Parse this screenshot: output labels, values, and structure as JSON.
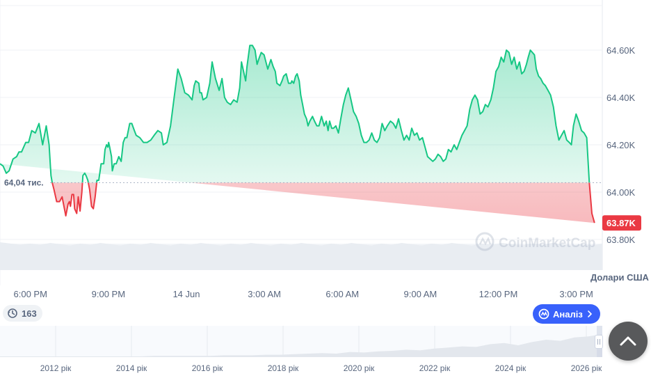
{
  "chart_data": {
    "type": "area",
    "baseline": {
      "value": 64040,
      "label": "64,04 тис."
    },
    "current": {
      "value": 63870,
      "label": "63.87K"
    },
    "ylim": [
      63800,
      64660
    ],
    "yticks": [
      {
        "value": 64600,
        "label": "64.60K"
      },
      {
        "value": 64400,
        "label": "64.40K"
      },
      {
        "value": 64200,
        "label": "64.20K"
      },
      {
        "value": 64000,
        "label": "64.00K"
      },
      {
        "value": 63800,
        "label": "63.80K"
      }
    ],
    "currency_label": "Долари США",
    "watermark": "CoinMarketCap",
    "xlim": [
      16.83,
      40.0
    ],
    "xticks": [
      {
        "value": 18,
        "label": "6:00 PM"
      },
      {
        "value": 21,
        "label": "9:00 PM"
      },
      {
        "value": 24,
        "label": "14 Jun"
      },
      {
        "value": 27,
        "label": "3:00 AM"
      },
      {
        "value": 30,
        "label": "6:00 AM"
      },
      {
        "value": 33,
        "label": "9:00 AM"
      },
      {
        "value": 36,
        "label": "12:00 PM"
      },
      {
        "value": 39,
        "label": "3:00 PM"
      }
    ],
    "x": [
      16.83,
      16.95,
      17.07,
      17.18,
      17.33,
      17.47,
      17.56,
      17.66,
      17.82,
      17.93,
      18.05,
      18.19,
      18.33,
      18.47,
      18.61,
      18.72,
      18.79,
      18.84,
      18.91,
      19.01,
      19.12,
      19.22,
      19.36,
      19.45,
      19.5,
      19.54,
      19.6,
      19.66,
      19.7,
      19.78,
      19.84,
      19.91,
      19.98,
      20.02,
      20.09,
      20.14,
      20.21,
      20.28,
      20.35,
      20.42,
      20.49,
      20.56,
      20.63,
      20.72,
      20.82,
      20.87,
      20.93,
      20.98,
      21.01,
      21.05,
      21.12,
      21.15,
      21.22,
      21.3,
      21.4,
      21.49,
      21.57,
      21.64,
      21.71,
      21.82,
      21.9,
      22.0,
      22.07,
      22.21,
      22.35,
      22.49,
      22.63,
      22.76,
      22.9,
      23.04,
      23.11,
      23.25,
      23.39,
      23.53,
      23.67,
      23.8,
      23.94,
      24.08,
      24.22,
      24.3,
      24.36,
      24.48,
      24.52,
      24.58,
      24.64,
      24.78,
      24.9,
      24.99,
      25.12,
      25.26,
      25.37,
      25.47,
      25.57,
      25.7,
      25.82,
      25.95,
      26.05,
      26.12,
      26.2,
      26.28,
      26.33,
      26.44,
      26.54,
      26.64,
      26.72,
      26.81,
      26.88,
      26.99,
      27.13,
      27.25,
      27.34,
      27.42,
      27.48,
      27.6,
      27.68,
      27.74,
      27.84,
      27.93,
      28.02,
      28.06,
      28.13,
      28.2,
      28.26,
      28.34,
      28.4,
      28.47,
      28.54,
      28.62,
      28.68,
      28.75,
      28.85,
      28.93,
      29.02,
      29.1,
      29.2,
      29.3,
      29.38,
      29.45,
      29.51,
      29.59,
      29.66,
      29.75,
      29.85,
      29.94,
      30.04,
      30.13,
      30.23,
      30.33,
      30.43,
      30.53,
      30.63,
      30.73,
      30.83,
      30.93,
      31.03,
      31.13,
      31.23,
      31.33,
      31.43,
      31.53,
      31.63,
      31.73,
      31.85,
      31.96,
      32.06,
      32.16,
      32.27,
      32.37,
      32.47,
      32.57,
      32.67,
      32.77,
      32.87,
      32.97,
      33.08,
      33.18,
      33.28,
      33.38,
      33.48,
      33.58,
      33.68,
      33.78,
      33.88,
      33.98,
      34.08,
      34.18,
      34.3,
      34.4,
      34.5,
      34.6,
      34.7,
      34.8,
      34.9,
      35.0,
      35.1,
      35.2,
      35.3,
      35.4,
      35.5,
      35.6,
      35.71,
      35.81,
      35.91,
      36.01,
      36.11,
      36.21,
      36.31,
      36.41,
      36.51,
      36.61,
      36.71,
      36.81,
      36.9,
      36.99,
      37.08,
      37.15,
      37.23,
      37.31,
      37.39,
      37.46,
      37.55,
      37.63,
      37.72,
      37.81,
      37.91,
      38.01,
      38.12,
      38.22,
      38.33,
      38.43,
      38.53,
      38.63,
      38.73,
      38.81,
      38.89,
      38.99,
      39.09,
      39.2,
      39.3,
      39.4,
      39.5,
      39.6,
      39.7,
      39.81,
      39.92,
      40.0
    ],
    "values": [
      64120,
      64110,
      64080,
      64090,
      64140,
      64150,
      64170,
      64170,
      64210,
      64210,
      64260,
      64250,
      64290,
      64200,
      64280,
      64200,
      64070,
      64040,
      64010,
      63960,
      63960,
      63980,
      63900,
      63950,
      63960,
      63940,
      63990,
      63990,
      63930,
      63910,
      63980,
      63920,
      64000,
      64070,
      64080,
      64070,
      64050,
      64010,
      63940,
      63930,
      63980,
      64050,
      64050,
      64120,
      64120,
      64180,
      64200,
      64190,
      64210,
      64190,
      64150,
      64090,
      64120,
      64120,
      64150,
      64130,
      64210,
      64230,
      64230,
      64290,
      64290,
      64260,
      64240,
      64230,
      64210,
      64210,
      64220,
      64240,
      64260,
      64250,
      64200,
      64210,
      64280,
      64400,
      64520,
      64480,
      64420,
      64410,
      64390,
      64450,
      64470,
      64460,
      64420,
      64420,
      64390,
      64400,
      64460,
      64550,
      64480,
      64430,
      64480,
      64400,
      64380,
      64370,
      64390,
      64380,
      64440,
      64550,
      64510,
      64470,
      64530,
      64620,
      64620,
      64600,
      64540,
      64570,
      64590,
      64580,
      64520,
      64560,
      64530,
      64510,
      64460,
      64450,
      64470,
      64490,
      64500,
      64460,
      64460,
      64470,
      64460,
      64490,
      64500,
      64470,
      64410,
      64370,
      64330,
      64310,
      64280,
      64300,
      64320,
      64300,
      64280,
      64280,
      64320,
      64280,
      64300,
      64260,
      64300,
      64270,
      64270,
      64280,
      64250,
      64310,
      64370,
      64410,
      64440,
      64390,
      64340,
      64320,
      64290,
      64240,
      64210,
      64210,
      64220,
      64250,
      64220,
      64210,
      64230,
      64290,
      64260,
      64280,
      64300,
      64290,
      64270,
      64310,
      64260,
      64220,
      64240,
      64220,
      64270,
      64240,
      64250,
      64220,
      64230,
      64190,
      64150,
      64140,
      64130,
      64140,
      64160,
      64150,
      64130,
      64140,
      64180,
      64170,
      64200,
      64180,
      64210,
      64240,
      64260,
      64280,
      64350,
      64390,
      64410,
      64390,
      64330,
      64340,
      64370,
      64360,
      64390,
      64440,
      64510,
      64530,
      64570,
      64550,
      64600,
      64590,
      64540,
      64570,
      64520,
      64550,
      64500,
      64510,
      64540,
      64570,
      64600,
      64590,
      64580,
      64520,
      64490,
      64480,
      64460,
      64450,
      64430,
      64410,
      64360,
      64280,
      64220,
      64240,
      64260,
      64220,
      64210,
      64200,
      64280,
      64330,
      64300,
      64260,
      64250,
      64230,
      64040,
      63910,
      63870
    ]
  },
  "navigator": {
    "labels": [
      "2012 рік",
      "2014 рік",
      "2016 рік",
      "2018 рік",
      "2020 рік",
      "2022 рік",
      "2024 рік",
      "2026 рік"
    ],
    "volume": [
      0,
      0,
      0,
      0,
      0,
      0,
      0,
      0,
      0,
      0,
      0,
      1,
      1,
      1,
      1,
      1,
      2,
      2,
      2,
      3,
      3,
      4,
      5,
      6,
      5,
      8,
      7,
      9,
      10,
      12,
      11,
      14,
      16,
      18,
      17,
      22,
      24,
      20,
      26,
      30,
      28,
      34,
      36,
      40
    ]
  },
  "history_button": {
    "count": "163"
  },
  "analysis_button": {
    "label": "Аналіз"
  },
  "colors": {
    "up": "#16c784",
    "down": "#ea3943",
    "accent": "#3861fb"
  }
}
